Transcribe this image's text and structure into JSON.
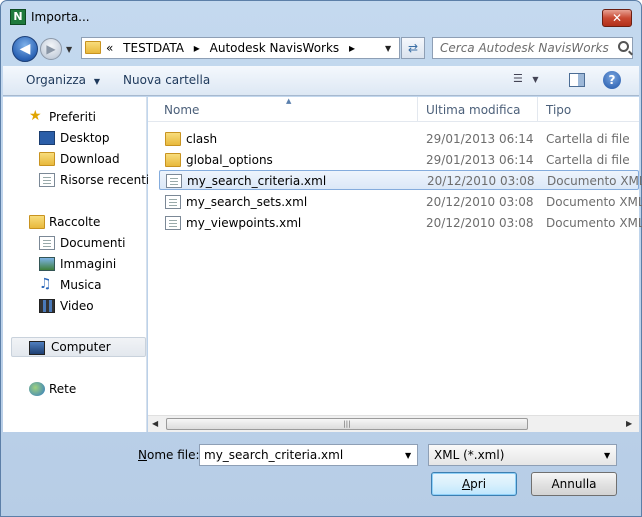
{
  "window": {
    "title": "Importa...",
    "app_icon_letter": "N",
    "close_glyph": "✕"
  },
  "address_bar": {
    "breadcrumb_overflow": "«",
    "breadcrumbs": [
      "TESTDATA",
      "Autodesk NavisWorks"
    ],
    "search_placeholder": "Cerca Autodesk NavisWorks"
  },
  "toolbar": {
    "organize_label": "Organizza",
    "new_folder_label": "Nuova cartella",
    "help_glyph": "?"
  },
  "sidebar": {
    "favorites": {
      "label": "Preferiti",
      "items": [
        {
          "label": "Desktop",
          "icon": "desktop-icon"
        },
        {
          "label": "Download",
          "icon": "download-folder-icon"
        },
        {
          "label": "Risorse recenti",
          "icon": "recent-places-icon"
        }
      ]
    },
    "libraries": {
      "label": "Raccolte",
      "items": [
        {
          "label": "Documenti",
          "icon": "documents-icon"
        },
        {
          "label": "Immagini",
          "icon": "pictures-icon"
        },
        {
          "label": "Musica",
          "icon": "music-icon"
        },
        {
          "label": "Video",
          "icon": "video-icon"
        }
      ]
    },
    "computer_label": "Computer",
    "network_label": "Rete"
  },
  "file_list": {
    "columns": [
      "Nome",
      "Ultima modifica",
      "Tipo"
    ],
    "rows": [
      {
        "name": "clash",
        "modified": "29/01/2013 06:14",
        "type": "Cartella di file",
        "kind": "folder",
        "selected": false
      },
      {
        "name": "global_options",
        "modified": "29/01/2013 06:14",
        "type": "Cartella di file",
        "kind": "folder",
        "selected": false
      },
      {
        "name": "my_search_criteria.xml",
        "modified": "20/12/2010 03:08",
        "type": "Documento XML",
        "kind": "xml",
        "selected": true
      },
      {
        "name": "my_search_sets.xml",
        "modified": "20/12/2010 03:08",
        "type": "Documento XML",
        "kind": "xml",
        "selected": false
      },
      {
        "name": "my_viewpoints.xml",
        "modified": "20/12/2010 03:08",
        "type": "Documento XML",
        "kind": "xml",
        "selected": false
      }
    ]
  },
  "bottom": {
    "filename_label_accel": "N",
    "filename_label_rest": "ome file:",
    "filename_value": "my_search_criteria.xml",
    "filetype_value": "XML (*.xml)",
    "open_label_accel": "A",
    "open_label_rest": "pri",
    "cancel_label": "Annulla"
  }
}
